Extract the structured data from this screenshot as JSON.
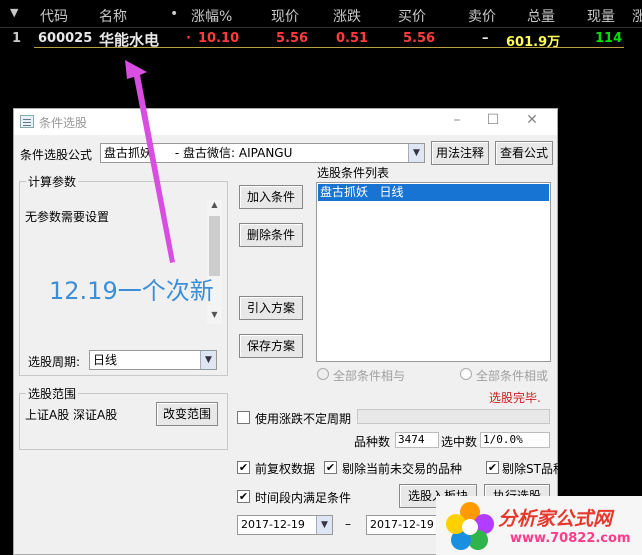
{
  "header": {
    "arrow": "▼",
    "cols": [
      "代码",
      "名称",
      "•",
      "涨幅%",
      "现价",
      "涨跌",
      "买价",
      "卖价",
      "总量",
      "现量",
      "涨"
    ]
  },
  "stock": {
    "index": "1",
    "code": "600025",
    "name": "华能水电",
    "tick": "·",
    "change_pct": "10.10",
    "price": "5.56",
    "change": "0.51",
    "bid": "5.56",
    "ask": "–",
    "volume": "601.9万",
    "cur_vol": "114",
    "colors": {
      "gain": "#ff3c3c",
      "volume": "#ffff55",
      "cur": "#00e000"
    }
  },
  "overlay": {
    "text": "12.19一个次新",
    "color": "#3a8fd8",
    "arrow_color": "#d84ee0"
  },
  "dialog": {
    "title": "条件选股",
    "formula_label": "条件选股公式",
    "formula_value": "盘古抓妖      - 盘古微信: AIPANGU",
    "usage_btn": "用法注释",
    "view_btn": "查看公式",
    "params_group": "计算参数",
    "params_text": "无参数需要设置",
    "period_label": "选股周期:",
    "period_value": "日线",
    "scope_group": "选股范围",
    "scope_text": "上证A股  深证A股",
    "change_scope_btn": "改变范围",
    "add_btn": "加入条件",
    "del_btn": "删除条件",
    "import_btn": "引入方案",
    "save_btn": "保存方案",
    "list_label": "选股条件列表",
    "list_items": [
      "盘古抓妖   日线"
    ],
    "and_label": "全部条件相与",
    "or_label": "全部条件相或",
    "status": "选股完毕.",
    "variable_period": "使用涨跌不定周期",
    "count_label": "品种数",
    "count_value": "3474",
    "selected_label": "选中数",
    "selected_value": "1/0.0%",
    "restore": "前复权数据",
    "exclude_untraded": "剔除当前未交易的品种",
    "exclude_st": "剔除ST品种",
    "time_range": "时间段内满足条件",
    "to_block_btn": "选股入板块",
    "run_btn": "执行选股",
    "date_from": "2017-12-19",
    "date_sep": "–",
    "date_to": "2017-12-19"
  },
  "watermark": {
    "text": "分析家公式网",
    "url": "www.70822.com"
  }
}
